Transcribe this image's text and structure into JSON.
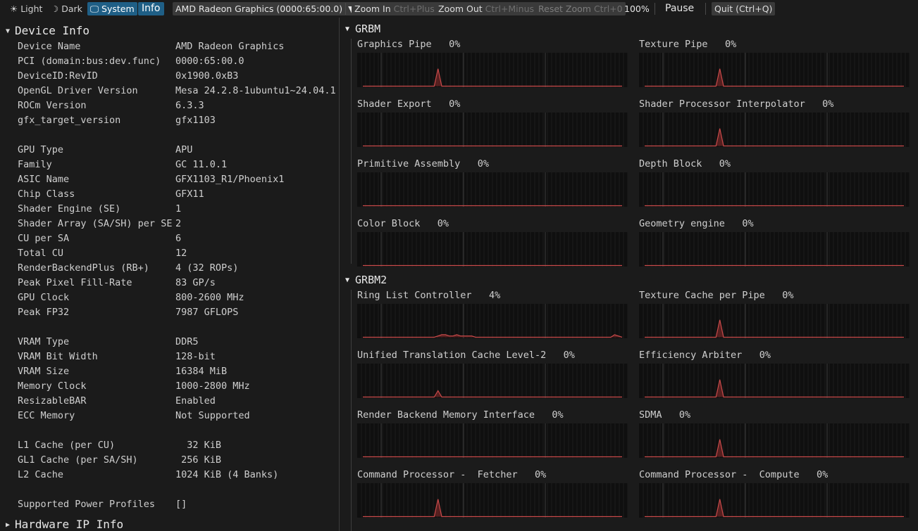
{
  "toolbar": {
    "theme_light": "Light",
    "theme_dark": "Dark",
    "theme_system": "System",
    "info_toggle": "Info",
    "device_select": "AMD Radeon Graphics (0000:65:00.0)",
    "zoom_in": "Zoom In",
    "zoom_in_shortcut": "Ctrl+Plus",
    "zoom_out": "Zoom Out",
    "zoom_out_shortcut": "Ctrl+Minus",
    "reset_zoom": "Reset Zoom",
    "reset_zoom_shortcut": "Ctrl+0",
    "zoom_level": "100%",
    "pause": "Pause",
    "quit": "Quit (Ctrl+Q)",
    "selected_theme": "System",
    "accent_color": "#1f5f86"
  },
  "device_info": {
    "title": "Device Info",
    "rows": [
      {
        "label": "Device Name",
        "value": "AMD Radeon Graphics"
      },
      {
        "label": "PCI (domain:bus:dev.func)",
        "value": "0000:65:00.0"
      },
      {
        "label": "DeviceID:RevID",
        "value": "0x1900.0xB3"
      },
      {
        "label": "OpenGL Driver Version",
        "value": "Mesa 24.2.8-1ubuntu1~24.04.1"
      },
      {
        "label": "ROCm Version",
        "value": "6.3.3"
      },
      {
        "label": "gfx_target_version",
        "value": "gfx1103"
      },
      {
        "label": "GPU Type",
        "value": "APU"
      },
      {
        "label": "Family",
        "value": "GC 11.0.1"
      },
      {
        "label": "ASIC Name",
        "value": "GFX1103_R1/Phoenix1"
      },
      {
        "label": "Chip Class",
        "value": "GFX11"
      },
      {
        "label": "Shader Engine (SE)",
        "value": "1"
      },
      {
        "label": "Shader Array (SA/SH) per SE",
        "value": "2"
      },
      {
        "label": "CU per SA",
        "value": "6"
      },
      {
        "label": "Total CU",
        "value": "12"
      },
      {
        "label": "RenderBackendPlus (RB+)",
        "value": "4 (32 ROPs)"
      },
      {
        "label": "Peak Pixel Fill-Rate",
        "value": "83 GP/s"
      },
      {
        "label": "GPU Clock",
        "value": "800-2600 MHz"
      },
      {
        "label": "Peak FP32",
        "value": "7987 GFLOPS"
      },
      {
        "label": "VRAM Type",
        "value": "DDR5"
      },
      {
        "label": "VRAM Bit Width",
        "value": "128-bit"
      },
      {
        "label": "VRAM Size",
        "value": "16384 MiB"
      },
      {
        "label": "Memory Clock",
        "value": "1000-2800 MHz"
      },
      {
        "label": "ResizableBAR",
        "value": "Enabled"
      },
      {
        "label": "ECC Memory",
        "value": "Not Supported"
      },
      {
        "label": "L1 Cache (per CU)",
        "value": "  32 KiB"
      },
      {
        "label": "GL1 Cache (per SA/SH)",
        "value": " 256 KiB"
      },
      {
        "label": "L2 Cache",
        "value": "1024 KiB (4 Banks)"
      },
      {
        "label": "Supported Power Profiles",
        "value": "[]"
      }
    ]
  },
  "hardware_ip": {
    "title": "Hardware IP Info"
  },
  "groups": [
    {
      "title": "GRBM",
      "metrics": [
        {
          "name": "Graphics Pipe",
          "value": "0%"
        },
        {
          "name": "Texture Pipe",
          "value": "0%"
        },
        {
          "name": "Shader Export",
          "value": "0%"
        },
        {
          "name": "Shader Processor Interpolator",
          "value": "0%"
        },
        {
          "name": "Primitive Assembly",
          "value": "0%"
        },
        {
          "name": "Depth Block",
          "value": "0%"
        },
        {
          "name": "Color Block",
          "value": "0%"
        },
        {
          "name": "Geometry engine",
          "value": "0%"
        }
      ]
    },
    {
      "title": "GRBM2",
      "metrics": [
        {
          "name": "Ring List Controller",
          "value": "4%"
        },
        {
          "name": "Texture Cache per Pipe",
          "value": "0%"
        },
        {
          "name": "Unified Translation Cache Level-2",
          "value": "0%"
        },
        {
          "name": "Efficiency Arbiter",
          "value": "0%"
        },
        {
          "name": "Render Backend Memory Interface",
          "value": "0%"
        },
        {
          "name": "SDMA",
          "value": "0%"
        },
        {
          "name": "Command Processor -  Fetcher",
          "value": "0%"
        },
        {
          "name": "Command Processor -  Compute",
          "value": "0%"
        }
      ]
    }
  ],
  "graph_style": {
    "line_color": "#c94a4a",
    "fill_color": "#6e2626",
    "grid_color": "#353535",
    "bg_color": "#0f0f0f"
  },
  "graph_series": [
    [
      0,
      0,
      0,
      0,
      0,
      0,
      0,
      0,
      0,
      0,
      0,
      0,
      0,
      0,
      0,
      0,
      0,
      0,
      0,
      0,
      55,
      0,
      0,
      0,
      0,
      0,
      0,
      0,
      0,
      0,
      0,
      0,
      0,
      0,
      0,
      0,
      0,
      0,
      0,
      0,
      0,
      0,
      0,
      0,
      0,
      0,
      0,
      0,
      0,
      0,
      0,
      0,
      0,
      0,
      0,
      0,
      0,
      0,
      0,
      0,
      0,
      0,
      0,
      0,
      0,
      0,
      0,
      0,
      0,
      0
    ],
    [
      0,
      0,
      0,
      0,
      0,
      0,
      0,
      0,
      0,
      0,
      0,
      0,
      0,
      0,
      0,
      0,
      0,
      0,
      0,
      0,
      55,
      0,
      0,
      0,
      0,
      0,
      0,
      0,
      0,
      0,
      0,
      0,
      0,
      0,
      0,
      0,
      0,
      0,
      0,
      0,
      0,
      0,
      0,
      0,
      0,
      0,
      0,
      0,
      0,
      0,
      0,
      0,
      0,
      0,
      0,
      0,
      0,
      0,
      0,
      0,
      0,
      0,
      0,
      0,
      0,
      0,
      0,
      0,
      0,
      0
    ],
    [
      0,
      0,
      0,
      0,
      0,
      0,
      0,
      0,
      0,
      0,
      0,
      0,
      0,
      0,
      0,
      0,
      0,
      0,
      0,
      0,
      0,
      0,
      0,
      0,
      0,
      0,
      0,
      0,
      0,
      0,
      0,
      0,
      0,
      0,
      0,
      0,
      0,
      0,
      0,
      0,
      0,
      0,
      0,
      0,
      0,
      0,
      0,
      0,
      0,
      0,
      0,
      0,
      0,
      0,
      0,
      0,
      0,
      0,
      0,
      0,
      0,
      0,
      0,
      0,
      0,
      0,
      0,
      0,
      0,
      0
    ],
    [
      0,
      0,
      0,
      0,
      0,
      0,
      0,
      0,
      0,
      0,
      0,
      0,
      0,
      0,
      0,
      0,
      0,
      0,
      0,
      0,
      55,
      0,
      0,
      0,
      0,
      0,
      0,
      0,
      0,
      0,
      0,
      0,
      0,
      0,
      0,
      0,
      0,
      0,
      0,
      0,
      0,
      0,
      0,
      0,
      0,
      0,
      0,
      0,
      0,
      0,
      0,
      0,
      0,
      0,
      0,
      0,
      0,
      0,
      0,
      0,
      0,
      0,
      0,
      0,
      0,
      0,
      0,
      0,
      0,
      0
    ],
    [
      0,
      0,
      0,
      0,
      0,
      0,
      0,
      0,
      0,
      0,
      0,
      0,
      0,
      0,
      0,
      0,
      0,
      0,
      0,
      0,
      0,
      0,
      0,
      0,
      0,
      0,
      0,
      0,
      0,
      0,
      0,
      0,
      0,
      0,
      0,
      0,
      0,
      0,
      0,
      0,
      0,
      0,
      0,
      0,
      0,
      0,
      0,
      0,
      0,
      0,
      0,
      0,
      0,
      0,
      0,
      0,
      0,
      0,
      0,
      0,
      0,
      0,
      0,
      0,
      0,
      0,
      0,
      0,
      0,
      0
    ],
    [
      0,
      0,
      0,
      0,
      0,
      0,
      0,
      0,
      0,
      0,
      0,
      0,
      0,
      0,
      0,
      0,
      0,
      0,
      0,
      0,
      0,
      0,
      0,
      0,
      0,
      0,
      0,
      0,
      0,
      0,
      0,
      0,
      0,
      0,
      0,
      0,
      0,
      0,
      0,
      0,
      0,
      0,
      0,
      0,
      0,
      0,
      0,
      0,
      0,
      0,
      0,
      0,
      0,
      0,
      0,
      0,
      0,
      0,
      0,
      0,
      0,
      0,
      0,
      0,
      0,
      0,
      0,
      0,
      0,
      0
    ],
    [
      0,
      0,
      0,
      0,
      0,
      0,
      0,
      0,
      0,
      0,
      0,
      0,
      0,
      0,
      0,
      0,
      0,
      0,
      0,
      0,
      0,
      0,
      0,
      0,
      0,
      0,
      0,
      0,
      0,
      0,
      0,
      0,
      0,
      0,
      0,
      0,
      0,
      0,
      0,
      0,
      0,
      0,
      0,
      0,
      0,
      0,
      0,
      0,
      0,
      0,
      0,
      0,
      0,
      0,
      0,
      0,
      0,
      0,
      0,
      0,
      0,
      0,
      0,
      0,
      0,
      0,
      0,
      0,
      0,
      0
    ],
    [
      0,
      0,
      0,
      0,
      0,
      0,
      0,
      0,
      0,
      0,
      0,
      0,
      0,
      0,
      0,
      0,
      0,
      0,
      0,
      0,
      0,
      0,
      0,
      0,
      0,
      0,
      0,
      0,
      0,
      0,
      0,
      0,
      0,
      0,
      0,
      0,
      0,
      0,
      0,
      0,
      0,
      0,
      0,
      0,
      0,
      0,
      0,
      0,
      0,
      0,
      0,
      0,
      0,
      0,
      0,
      0,
      0,
      0,
      0,
      0,
      0,
      0,
      0,
      0,
      0,
      0,
      0,
      0,
      0,
      0
    ],
    [
      0,
      0,
      0,
      0,
      0,
      0,
      0,
      0,
      0,
      0,
      0,
      0,
      0,
      0,
      0,
      0,
      0,
      0,
      0,
      0,
      4,
      8,
      8,
      4,
      4,
      8,
      4,
      4,
      4,
      4,
      0,
      0,
      0,
      0,
      0,
      0,
      0,
      0,
      0,
      0,
      0,
      0,
      0,
      0,
      0,
      0,
      0,
      0,
      0,
      0,
      0,
      0,
      0,
      0,
      0,
      0,
      0,
      0,
      0,
      0,
      0,
      0,
      0,
      0,
      0,
      0,
      0,
      8,
      4,
      0
    ],
    [
      0,
      0,
      0,
      0,
      0,
      0,
      0,
      0,
      0,
      0,
      0,
      0,
      0,
      0,
      0,
      0,
      0,
      0,
      0,
      0,
      55,
      0,
      0,
      0,
      0,
      0,
      0,
      0,
      0,
      0,
      0,
      0,
      0,
      0,
      0,
      0,
      0,
      0,
      0,
      0,
      0,
      0,
      0,
      0,
      0,
      0,
      0,
      0,
      0,
      0,
      0,
      0,
      0,
      0,
      0,
      0,
      0,
      0,
      0,
      0,
      0,
      0,
      0,
      0,
      0,
      0,
      0,
      0,
      0,
      0
    ],
    [
      0,
      0,
      0,
      0,
      0,
      0,
      0,
      0,
      0,
      0,
      0,
      0,
      0,
      0,
      0,
      0,
      0,
      0,
      0,
      0,
      20,
      0,
      0,
      0,
      0,
      0,
      0,
      0,
      0,
      0,
      0,
      0,
      0,
      0,
      0,
      0,
      0,
      0,
      0,
      0,
      0,
      0,
      0,
      0,
      0,
      0,
      0,
      0,
      0,
      0,
      0,
      0,
      0,
      0,
      0,
      0,
      0,
      0,
      0,
      0,
      0,
      0,
      0,
      0,
      0,
      0,
      0,
      0,
      0,
      0
    ],
    [
      0,
      0,
      0,
      0,
      0,
      0,
      0,
      0,
      0,
      0,
      0,
      0,
      0,
      0,
      0,
      0,
      0,
      0,
      0,
      0,
      55,
      0,
      0,
      0,
      0,
      0,
      0,
      0,
      0,
      0,
      0,
      0,
      0,
      0,
      0,
      0,
      0,
      0,
      0,
      0,
      0,
      0,
      0,
      0,
      0,
      0,
      0,
      0,
      0,
      0,
      0,
      0,
      0,
      0,
      0,
      0,
      0,
      0,
      0,
      0,
      0,
      0,
      0,
      0,
      0,
      0,
      0,
      0,
      0,
      0
    ],
    [
      0,
      0,
      0,
      0,
      0,
      0,
      0,
      0,
      0,
      0,
      0,
      0,
      0,
      0,
      0,
      0,
      0,
      0,
      0,
      0,
      0,
      0,
      0,
      0,
      0,
      0,
      0,
      0,
      0,
      0,
      0,
      0,
      0,
      0,
      0,
      0,
      0,
      0,
      0,
      0,
      0,
      0,
      0,
      0,
      0,
      0,
      0,
      0,
      0,
      0,
      0,
      0,
      0,
      0,
      0,
      0,
      0,
      0,
      0,
      0,
      0,
      0,
      0,
      0,
      0,
      0,
      0,
      0,
      0,
      0
    ],
    [
      0,
      0,
      0,
      0,
      0,
      0,
      0,
      0,
      0,
      0,
      0,
      0,
      0,
      0,
      0,
      0,
      0,
      0,
      0,
      0,
      55,
      0,
      0,
      0,
      0,
      0,
      0,
      0,
      0,
      0,
      0,
      0,
      0,
      0,
      0,
      0,
      0,
      0,
      0,
      0,
      0,
      0,
      0,
      0,
      0,
      0,
      0,
      0,
      0,
      0,
      0,
      0,
      0,
      0,
      0,
      0,
      0,
      0,
      0,
      0,
      0,
      0,
      0,
      0,
      0,
      0,
      0,
      0,
      0,
      0
    ],
    [
      0,
      0,
      0,
      0,
      0,
      0,
      0,
      0,
      0,
      0,
      0,
      0,
      0,
      0,
      0,
      0,
      0,
      0,
      0,
      0,
      55,
      0,
      0,
      0,
      0,
      0,
      0,
      0,
      0,
      0,
      0,
      0,
      0,
      0,
      0,
      0,
      0,
      0,
      0,
      0,
      0,
      0,
      0,
      0,
      0,
      0,
      0,
      0,
      0,
      0,
      0,
      0,
      0,
      0,
      0,
      0,
      0,
      0,
      0,
      0,
      0,
      0,
      0,
      0,
      0,
      0,
      0,
      0,
      0,
      0
    ],
    [
      0,
      0,
      0,
      0,
      0,
      0,
      0,
      0,
      0,
      0,
      0,
      0,
      0,
      0,
      0,
      0,
      0,
      0,
      0,
      0,
      55,
      0,
      0,
      0,
      0,
      0,
      0,
      0,
      0,
      0,
      0,
      0,
      0,
      0,
      0,
      0,
      0,
      0,
      0,
      0,
      0,
      0,
      0,
      0,
      0,
      0,
      0,
      0,
      0,
      0,
      0,
      0,
      0,
      0,
      0,
      0,
      0,
      0,
      0,
      0,
      0,
      0,
      0,
      0,
      0,
      0,
      0,
      0,
      0,
      0
    ]
  ]
}
